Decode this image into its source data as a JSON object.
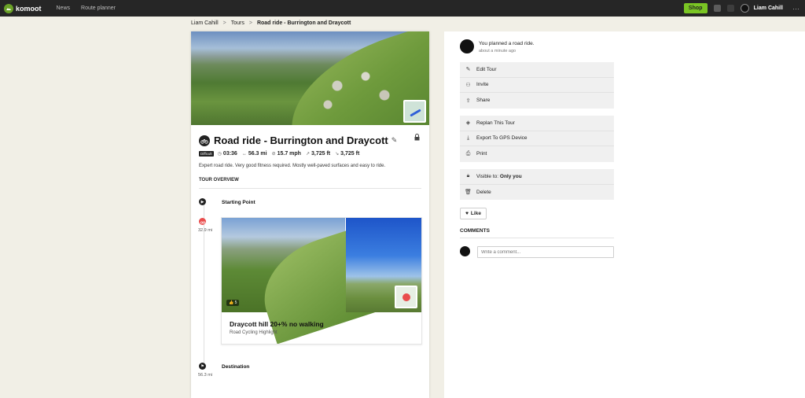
{
  "topbar": {
    "logo": "komoot",
    "nav": [
      "News",
      "Route planner"
    ],
    "shop_label": "Shop",
    "user_name": "Liam Cahill",
    "more": "···"
  },
  "breadcrumb": {
    "items": [
      "Liam Cahill",
      "Tours",
      "Road ride - Burrington and Draycott"
    ],
    "separator": ">"
  },
  "tour": {
    "title": "Road ride - Burrington and Draycott",
    "difficulty": "Difficult",
    "duration": "03:36",
    "distance": "56.3 mi",
    "speed": "15.7 mph",
    "elevation_up": "3,725 ft",
    "elevation_down": "3,725 ft",
    "description": "Expert road ride. Very good fitness required. Mostly well-paved surfaces and easy to ride.",
    "overview_label": "TOUR OVERVIEW"
  },
  "timeline": {
    "start_label": "Starting Point",
    "highlight_dist": "32.9 mi",
    "highlight": {
      "title": "Draycott hill 20+% no walking",
      "subtitle": "Road Cycling Highlight",
      "likes": "5"
    },
    "destination_label": "Destination",
    "destination_dist": "56.3 mi"
  },
  "activity": {
    "text": "You planned a road ride.",
    "time": "about a minute ago"
  },
  "actions": {
    "group1": [
      "Edit Tour",
      "Invite",
      "Share"
    ],
    "group2": [
      "Replan This Tour",
      "Export To GPS Device",
      "Print"
    ],
    "visible_prefix": "Visible to:",
    "visible_value": "Only you",
    "delete": "Delete"
  },
  "like_label": "Like",
  "comments": {
    "header": "COMMENTS",
    "placeholder": "Write a comment..."
  },
  "colors": {
    "accent": "#7ac524",
    "topbar": "#262626",
    "background": "#f1efe6",
    "waypoint_red": "#e94c4c"
  },
  "icons": [
    "komoot-logo-icon",
    "bell-icon",
    "plus-icon",
    "bike-icon",
    "pencil-icon",
    "lock-icon",
    "clock-icon",
    "distance-icon",
    "speed-icon",
    "uphill-icon",
    "downhill-icon",
    "play-icon",
    "highlight-icon",
    "flag-icon",
    "edit-icon",
    "invite-icon",
    "share-icon",
    "replan-icon",
    "download-icon",
    "print-icon",
    "trash-icon",
    "heart-icon"
  ]
}
